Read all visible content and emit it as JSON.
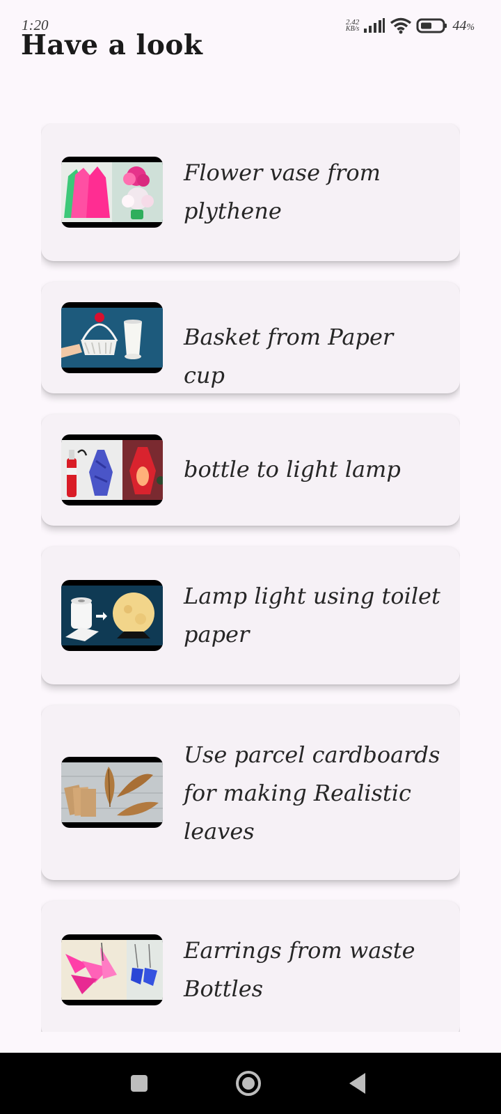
{
  "status_bar": {
    "time": "1:20",
    "net_speed_value": "2.42",
    "net_speed_unit": "KB/s",
    "battery_percent": "44",
    "battery_symbol": "%"
  },
  "page": {
    "title": "Have a look"
  },
  "cards": [
    {
      "title": "Flower vase from plythene",
      "thumb_icon": "flower-vase-thumbnail"
    },
    {
      "title": "Basket from Paper cup",
      "thumb_icon": "paper-cup-basket-thumbnail"
    },
    {
      "title": "bottle to light lamp",
      "thumb_icon": "bottle-lamp-thumbnail"
    },
    {
      "title": "Lamp light using toilet paper",
      "thumb_icon": "toilet-paper-lamp-thumbnail"
    },
    {
      "title": "Use parcel cardboards for making Realistic leaves",
      "thumb_icon": "cardboard-leaves-thumbnail"
    },
    {
      "title": "Earrings from waste Bottles",
      "thumb_icon": "bottle-earrings-thumbnail"
    }
  ],
  "nav": {
    "icons": [
      "recents-square-icon",
      "home-circle-icon",
      "back-triangle-icon"
    ]
  }
}
